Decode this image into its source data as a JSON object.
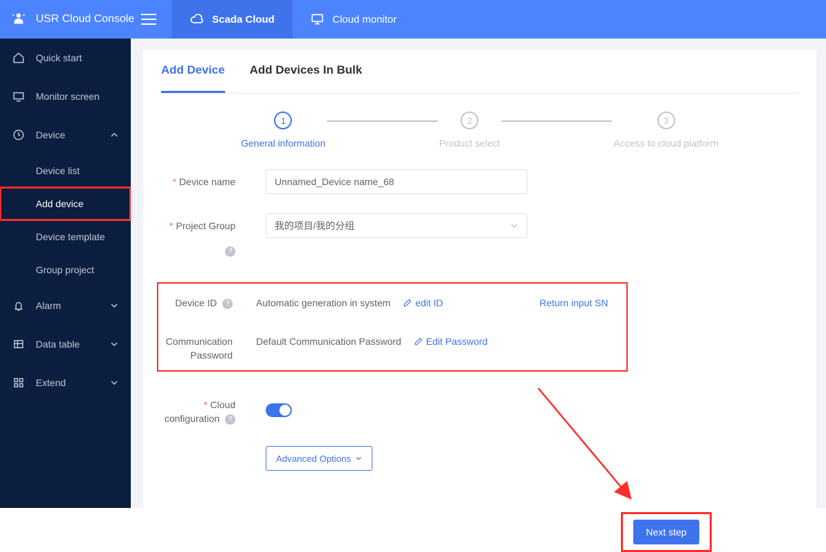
{
  "colors": {
    "accent": "#3e73ec",
    "topbar": "#4c84ff",
    "sidebar": "#0c1e3f",
    "danger_outline": "#ff2d2d"
  },
  "header": {
    "brand": "USR Cloud Console",
    "tabs": [
      {
        "label": "Scada Cloud",
        "active": true,
        "icon": "cloud-icon"
      },
      {
        "label": "Cloud monitor",
        "active": false,
        "icon": "monitor-icon"
      }
    ]
  },
  "sidebar": {
    "items": [
      {
        "icon": "home-icon",
        "label": "Quick start"
      },
      {
        "icon": "screen-icon",
        "label": "Monitor screen"
      },
      {
        "icon": "device-icon",
        "label": "Device",
        "expandable": true,
        "expanded": true,
        "children": [
          {
            "label": "Device list"
          },
          {
            "label": "Add device",
            "active": true
          },
          {
            "label": "Device template"
          },
          {
            "label": "Group project"
          }
        ]
      },
      {
        "icon": "alarm-icon",
        "label": "Alarm",
        "expandable": true
      },
      {
        "icon": "table-icon",
        "label": "Data table",
        "expandable": true
      },
      {
        "icon": "extend-icon",
        "label": "Extend",
        "expandable": true
      }
    ]
  },
  "page": {
    "tabs": [
      {
        "label": "Add Device",
        "active": true
      },
      {
        "label": "Add Devices In Bulk",
        "active": false
      }
    ],
    "steps": [
      {
        "num": "1",
        "label": "General information",
        "active": true
      },
      {
        "num": "2",
        "label": "Product select",
        "active": false
      },
      {
        "num": "3",
        "label": "Access to cloud platform",
        "active": false
      }
    ],
    "form": {
      "device_name": {
        "label": "Device name",
        "value": "Unnamed_Device name_68",
        "required": true
      },
      "project_group": {
        "label": "Project Group",
        "value": "我的项目/我的分组",
        "required": true,
        "help": true
      },
      "device_id": {
        "label": "Device ID",
        "text": "Automatic generation in system",
        "edit_label": "edit ID",
        "return_label": "Return input SN",
        "help": true
      },
      "comm_password": {
        "label": "Communication Password",
        "text": "Default Communication Password",
        "edit_label": "Edit Password"
      },
      "cloud_config": {
        "label": "Cloud configuration",
        "on": true,
        "required": true,
        "help": true
      },
      "advanced_label": "Advanced Options",
      "next_label": "Next step"
    }
  }
}
